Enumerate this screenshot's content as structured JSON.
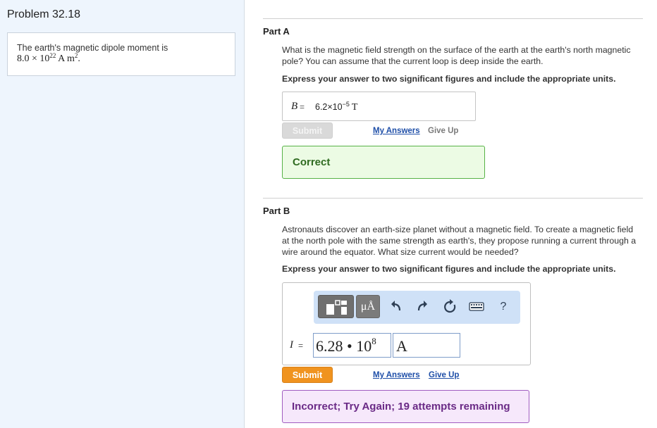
{
  "problem": {
    "title": "Problem 32.18",
    "intro_text": "The earth's magnetic dipole moment is",
    "intro_math_coef": "8.0 × 10",
    "intro_math_exp": "22",
    "intro_math_unit": " A m",
    "intro_math_unit_exp": "2",
    "intro_math_end": "."
  },
  "part_a": {
    "label": "Part A",
    "question": "What is the magnetic field strength on the surface of the earth at the earth's north magnetic pole? You can assume that the current loop is deep inside the earth.",
    "instruction": "Express your answer to two significant figures and include the appropriate units.",
    "answer_var": "B",
    "answer_eq": "=",
    "answer_base": "6.2×10",
    "answer_exp": "−5",
    "answer_unit": "T",
    "submit_label": "Submit",
    "my_answers_label": "My Answers",
    "give_up_label": "Give Up",
    "feedback": "Correct"
  },
  "part_b": {
    "label": "Part B",
    "question": "Astronauts discover an earth-size planet without a magnetic field. To create a magnetic field at the north pole with the same strength as earth's, they propose running a current through a wire around the equator. What size current would be needed?",
    "instruction": "Express your answer to two significant figures and include the appropriate units.",
    "toolbar": {
      "templates_icon": "template-blocks-icon",
      "units_label": "μÅ",
      "undo_icon": "undo-arrow-icon",
      "redo_icon": "redo-arrow-icon",
      "reset_icon": "reset-circle-icon",
      "keyboard_icon": "keyboard-icon",
      "help_label": "?"
    },
    "answer_var": "I",
    "answer_eq": "=",
    "value_base": "6.28 • 10",
    "value_exp": "8",
    "unit_value": "A",
    "submit_label": "Submit",
    "my_answers_label": "My Answers",
    "give_up_label": "Give Up",
    "feedback": "Incorrect; Try Again; 19 attempts remaining"
  },
  "colors": {
    "left_bg": "#eef5fd",
    "submit_orange": "#f0931f",
    "correct_green": "#57b246",
    "incorrect_purple": "#a05cc0",
    "link_blue": "#1f4fa8"
  }
}
